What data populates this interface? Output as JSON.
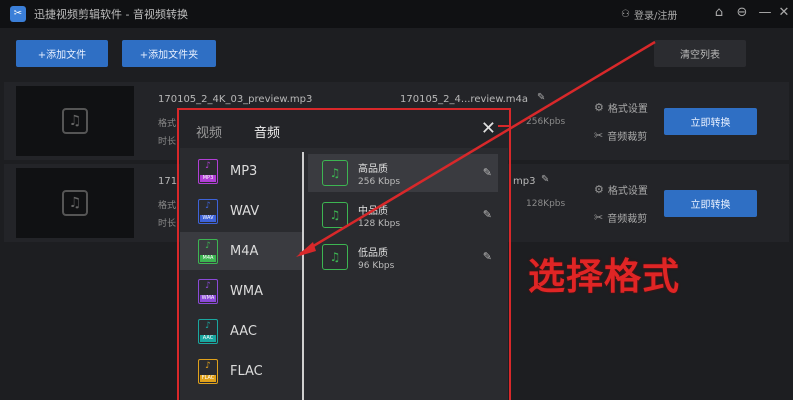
{
  "titlebar": {
    "app_title": "迅捷视频剪辑软件 - 音视频转换",
    "login": "登录/注册"
  },
  "toolbar": {
    "add_file": "+添加文件",
    "add_folder": "+添加文件夹",
    "clear_list": "清空列表"
  },
  "files": [
    {
      "name": "170105_2_4K_03_preview.mp3",
      "output": "170105_2_4...review.m4a",
      "meta1": "格式",
      "meta2": "时长",
      "bitrate": "256Kpbs",
      "settings": "格式设置",
      "clip": "音频裁剪",
      "convert": "立即转换"
    },
    {
      "name": "171",
      "output": "mp3",
      "meta1": "格式",
      "meta2": "时长",
      "bitrate": "128Kpbs",
      "settings": "格式设置",
      "clip": "音频裁剪",
      "convert": "立即转换"
    }
  ],
  "dialog": {
    "tabs": [
      "视频",
      "音频"
    ],
    "formats": [
      {
        "label": "MP3",
        "tag": "MP3",
        "color": "#b13fd6"
      },
      {
        "label": "WAV",
        "tag": "WAV",
        "color": "#3e63d9"
      },
      {
        "label": "M4A",
        "tag": "M4A",
        "color": "#3db552"
      },
      {
        "label": "WMA",
        "tag": "WMA",
        "color": "#8b4ad8"
      },
      {
        "label": "AAC",
        "tag": "AAC",
        "color": "#1aa7a0"
      },
      {
        "label": "FLAC",
        "tag": "FLAC",
        "color": "#e0a11b"
      }
    ],
    "selected_format": "M4A",
    "qualities": [
      {
        "title": "高品质",
        "sub": "256 Kbps"
      },
      {
        "title": "中品质",
        "sub": "128 Kbps"
      },
      {
        "title": "低品质",
        "sub": "96 Kbps"
      }
    ]
  },
  "annotation": "选择格式",
  "icons": {
    "note": "music-note-icon",
    "edit": "edit-icon",
    "gear": "gear-icon",
    "scissors": "scissors-icon",
    "home": "home-icon",
    "minimize": "minimize-icon",
    "close": "close-icon",
    "user": "user-icon"
  }
}
